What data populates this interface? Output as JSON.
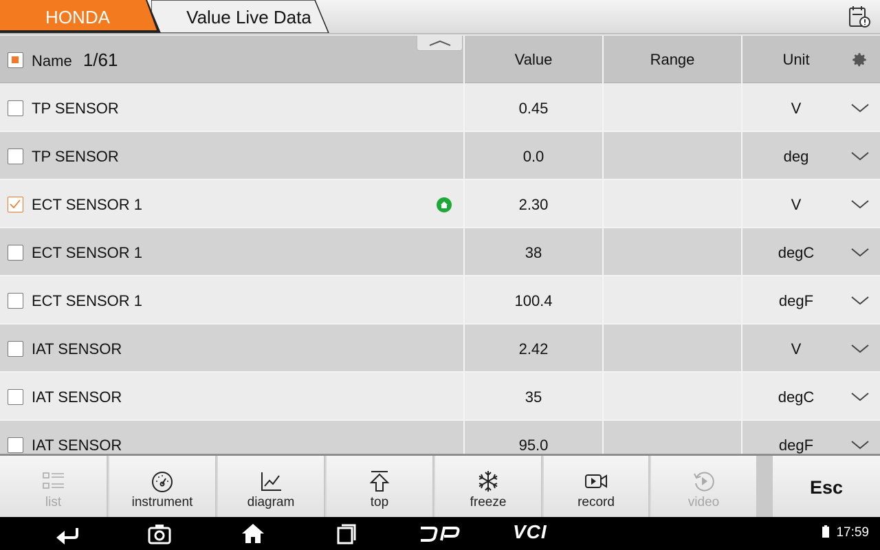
{
  "header": {
    "brand": "HONDA",
    "page_title": "Value Live Data",
    "brand_color": "#f47a20"
  },
  "table": {
    "columns": {
      "name": "Name",
      "page_indicator": "1/61",
      "value": "Value",
      "range": "Range",
      "unit": "Unit"
    },
    "rows": [
      {
        "name": "TP SENSOR",
        "value": "0.45",
        "range": "",
        "unit": "V",
        "checked": false
      },
      {
        "name": "TP SENSOR",
        "value": "0.0",
        "range": "",
        "unit": "deg",
        "checked": false
      },
      {
        "name": "ECT SENSOR 1",
        "value": "2.30",
        "range": "",
        "unit": "V",
        "checked": true
      },
      {
        "name": "ECT SENSOR 1",
        "value": "38",
        "range": "",
        "unit": "degC",
        "checked": false
      },
      {
        "name": "ECT SENSOR 1",
        "value": "100.4",
        "range": "",
        "unit": "degF",
        "checked": false
      },
      {
        "name": "IAT SENSOR",
        "value": "2.42",
        "range": "",
        "unit": "V",
        "checked": false
      },
      {
        "name": "IAT SENSOR",
        "value": "35",
        "range": "",
        "unit": "degC",
        "checked": false
      },
      {
        "name": "IAT SENSOR",
        "value": "95.0",
        "range": "",
        "unit": "degF",
        "checked": false
      }
    ]
  },
  "toolbar": {
    "list": "list",
    "instrument": "instrument",
    "diagram": "diagram",
    "top": "top",
    "freeze": "freeze",
    "record": "record",
    "video": "video",
    "esc": "Esc"
  },
  "status_bar": {
    "vci_label": "VCI",
    "time": "17:59"
  }
}
